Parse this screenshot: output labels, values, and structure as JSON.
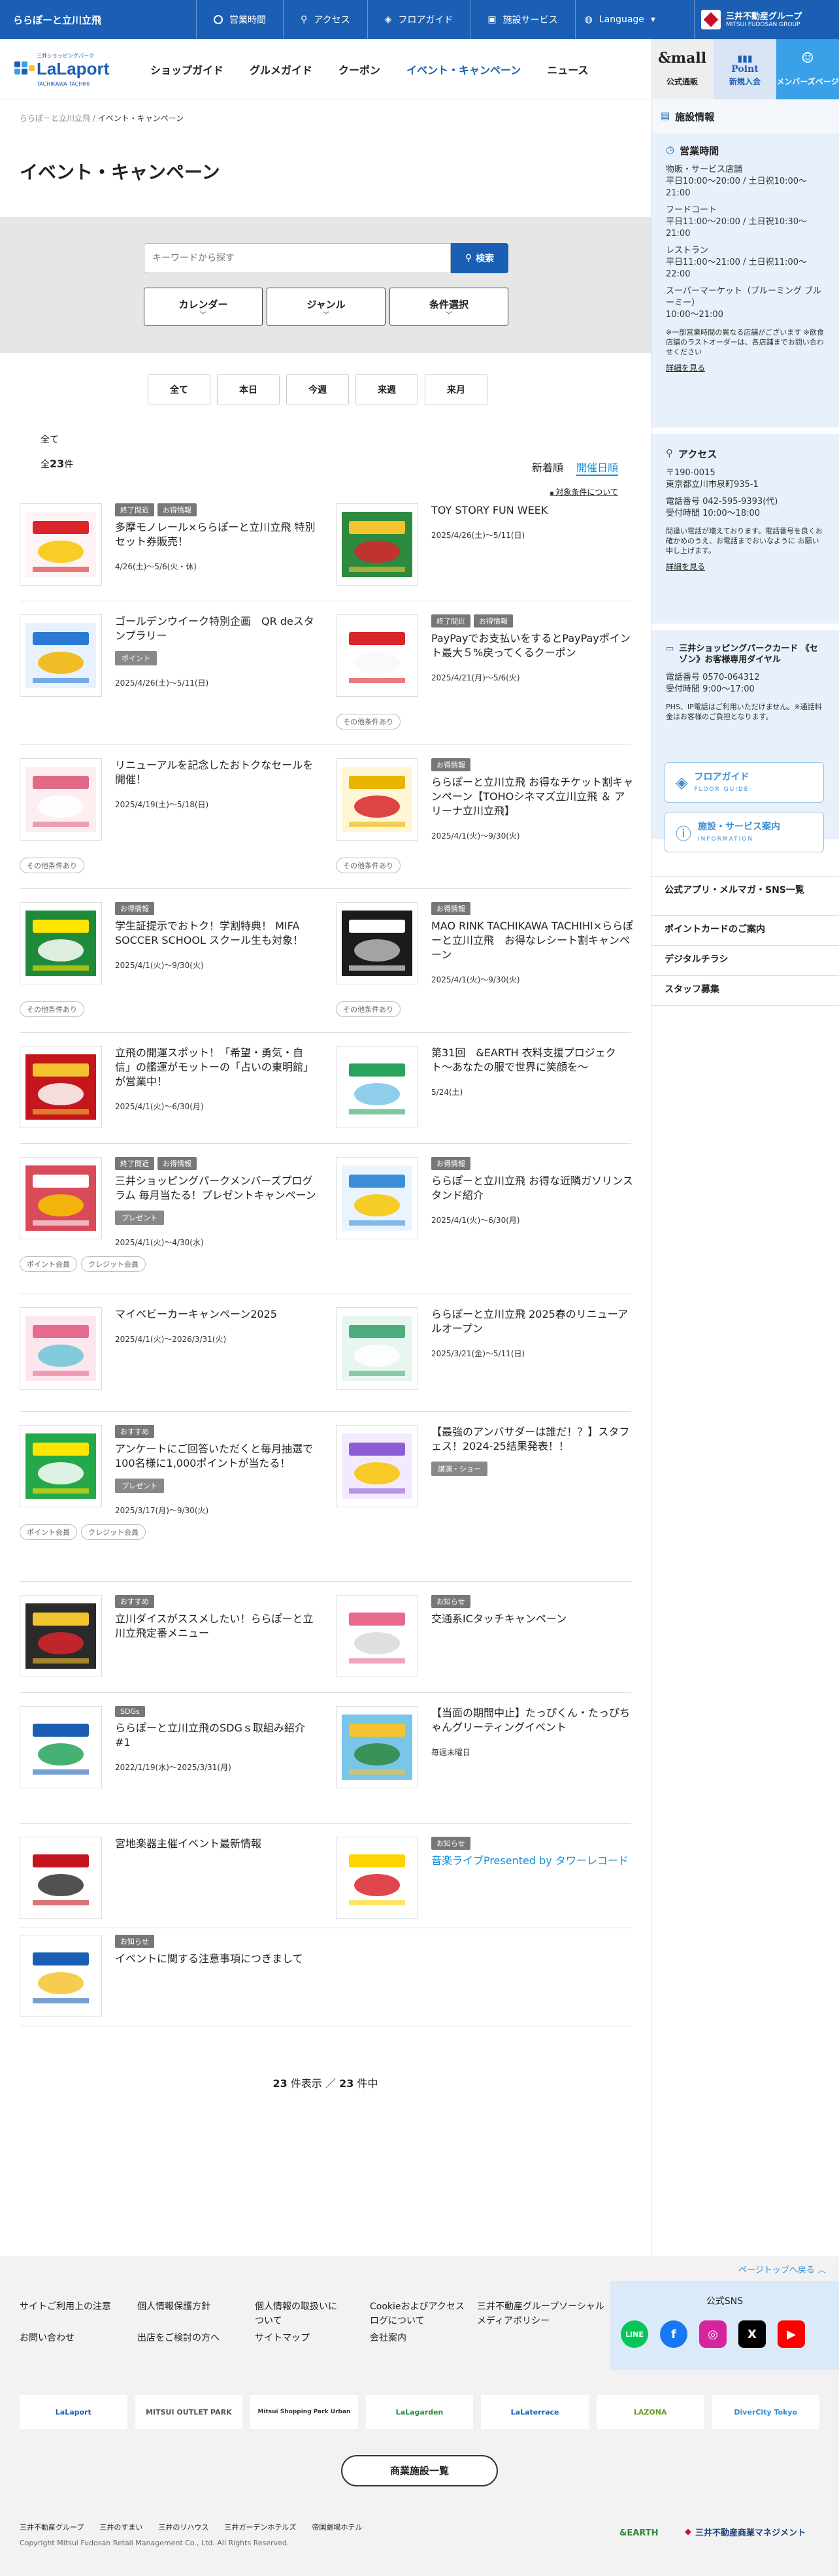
{
  "topbar": {
    "site_name": "ららぽーと立川立飛",
    "nav": [
      "営業時間",
      "アクセス",
      "フロアガイド",
      "施設サービス"
    ],
    "language": "Language",
    "group_name": "三井不動産グループ",
    "group_en": "MITSUI FUDOSAN GROUP"
  },
  "header": {
    "logo_small": "三井ショッピングパーク",
    "logo_main": "LaLaport",
    "logo_sub": "TACHIKAWA TACHIHI",
    "nav": [
      "ショップガイド",
      "グルメガイド",
      "クーポン",
      "イベント・キャンペーン",
      "ニュース"
    ],
    "mall_label": "公式通販",
    "mall_glyph": "&mall",
    "point_label": "新規入会",
    "point_glyph": "Point",
    "member_label": "メンバーズページ"
  },
  "breadcrumb": {
    "home": "ららぽーと立川立飛",
    "sep": "/",
    "current": "イベント・キャンペーン"
  },
  "page_title": "イベント・キャンペーン",
  "search": {
    "placeholder": "キーワードから探す",
    "button": "検索",
    "filters": [
      "カレンダー",
      "ジャンル",
      "条件選択"
    ],
    "chevron": "﹀"
  },
  "periods": [
    "全て",
    "本日",
    "今週",
    "来週",
    "来月"
  ],
  "list": {
    "filter_label": "全て",
    "count_prefix": "全",
    "count": "23",
    "count_suffix": "件",
    "sort_new": "新着順",
    "sort_date": "開催日順",
    "condition_link": "対象条件について"
  },
  "events": [
    {
      "tags": [
        "終了間近",
        "お得情報"
      ],
      "title": "多摩モノレール×ららぽーと立川立飛 特別セット券販売！",
      "date": "4/26(土)〜5/6(火・休)",
      "pills": [],
      "genre": "",
      "art": [
        "#fff3f3",
        "#d9252b",
        "#f7c600"
      ]
    },
    {
      "tags": [],
      "title": "TOY STORY FUN WEEK",
      "date": "2025/4/26(土)〜5/11(日)",
      "pills": [],
      "genre": "",
      "art": [
        "#2d8a3e",
        "#f4c430",
        "#d9252b"
      ]
    },
    {
      "tags": [],
      "title": "ゴールデンウイーク特別企画　QR deスタンプラリー",
      "date": "2025/4/26(土)〜5/11(日)",
      "pills": [],
      "genre": "ポイント",
      "art": [
        "#e8f2ff",
        "#2a7ad6",
        "#f2b400"
      ]
    },
    {
      "tags": [
        "終了間近",
        "お得情報"
      ],
      "title": "PayPayでお支払いをするとPayPayポイント最大５%戻ってくるクーポン",
      "date": "2025/4/21(月)〜5/6(火)",
      "pills": [
        "その他条件あり"
      ],
      "genre": "",
      "art": [
        "#ffffff",
        "#d9252b",
        "#f8f8f8"
      ]
    },
    {
      "tags": [],
      "title": "リニューアルを記念したおトクなセールを開催！",
      "date": "2025/4/19(土)〜5/18(日)",
      "pills": [
        "その他条件あり"
      ],
      "genre": "",
      "art": [
        "#fdeef0",
        "#e06a86",
        "#ffffff"
      ]
    },
    {
      "tags": [
        "お得情報"
      ],
      "title": "ららぽーと立川立飛 お得なチケット割キャンペーン【TOHOシネマズ立川立飛 ＆ アリーナ立川立飛】",
      "date": "2025/4/1(火)〜9/30(火)",
      "pills": [
        "その他条件あり"
      ],
      "genre": "",
      "art": [
        "#fff6d6",
        "#e8b400",
        "#d9252b"
      ]
    },
    {
      "tags": [
        "お得情報"
      ],
      "title": "学生証提示でおトク！学割特典！ MIFA SOCCER SCHOOL スクール生も対象！",
      "date": "2025/4/1(火)〜9/30(火)",
      "pills": [
        "その他条件あり"
      ],
      "genre": "",
      "art": [
        "#1e8a3a",
        "#ffe600",
        "#ffffff"
      ]
    },
    {
      "tags": [
        "お得情報"
      ],
      "title": "MAO RINK TACHIKAWA TACHIHI×ららぽーと立川立飛　お得なレシート割キャンペーン",
      "date": "2025/4/1(火)〜9/30(火)",
      "pills": [
        "その他条件あり"
      ],
      "genre": "",
      "art": [
        "#1b1b1b",
        "#ffffff",
        "#bbbbbb"
      ]
    },
    {
      "tags": [],
      "title": "立飛の開運スポット！「希望・勇気・自信」の艦運がモットーの「占いの東明館」が営業中！",
      "date": "2025/4/1(火)〜6/30(月)",
      "pills": [],
      "genre": "",
      "art": [
        "#c4161c",
        "#f4c430",
        "#ffffff"
      ]
    },
    {
      "tags": [],
      "title": "第31回　&EARTH 衣料支援プロジェクト〜あなたの服で世界に笑顔を〜",
      "date": "5/24(土)",
      "pills": [],
      "genre": "",
      "art": [
        "#ffffff",
        "#27a35a",
        "#7bc6e8"
      ]
    },
    {
      "tags": [
        "終了間近",
        "お得情報"
      ],
      "title": "三井ショッピングパークメンバーズプログラム 毎月当たる！プレゼントキャンペーン",
      "date": "2025/4/1(火)〜4/30(水)",
      "pills": [
        "ポイント会員",
        "クレジット会員"
      ],
      "genre": "プレゼント",
      "art": [
        "#d94a5a",
        "#ffffff",
        "#f7c600"
      ]
    },
    {
      "tags": [
        "お得情報"
      ],
      "title": "ららぽーと立川立飛 お得な近隣ガソリンスタンド紹介",
      "date": "2025/4/1(火)〜6/30(月)",
      "pills": [],
      "genre": "",
      "art": [
        "#e9f4ff",
        "#3a8fd6",
        "#f7c600"
      ]
    },
    {
      "tags": [],
      "title": "マイベビーカーキャンペーン2025",
      "date": "2025/4/1(火)〜2026/3/31(火)",
      "pills": [],
      "genre": "",
      "art": [
        "#fde7ee",
        "#e86a8f",
        "#6cc6d6"
      ]
    },
    {
      "tags": [],
      "title": "ららぽーと立川立飛 2025春のリニューアルオープン",
      "date": "2025/3/21(金)〜5/11(日)",
      "pills": [],
      "genre": "",
      "art": [
        "#e7f6ef",
        "#4cae7a",
        "#ffffff"
      ]
    },
    {
      "tags": [
        "おすすめ"
      ],
      "title": "アンケートにご回答いただくと毎月抽選で100名様に1,000ポイントが当たる！",
      "date": "2025/3/17(月)〜9/30(火)",
      "pills": [
        "ポイント会員",
        "クレジット会員"
      ],
      "genre": "プレゼント",
      "art": [
        "#25a84a",
        "#ffe600",
        "#ffffff"
      ]
    },
    {
      "tags": [],
      "title": "【最強のアンバサダーは誰だ！？】スタフェス！2024-25結果発表！！",
      "date": "",
      "pills": [],
      "genre": "講演・ショー",
      "art": [
        "#f4eaff",
        "#8e5cd6",
        "#f7c600"
      ]
    },
    {
      "tags": [
        "おすすめ"
      ],
      "title": "立川ダイスがススメしたい！ららぽーと立川立飛定番メニュー",
      "date": "",
      "pills": [],
      "genre": "",
      "art": [
        "#2a2a2a",
        "#f4c430",
        "#d9252b"
      ]
    },
    {
      "tags": [
        "お知らせ"
      ],
      "title": "交通系ICタッチキャンペーン",
      "date": "",
      "pills": [],
      "genre": "",
      "art": [
        "#ffffff",
        "#e86a8f",
        "#d9d9d9"
      ]
    },
    {
      "tags": [
        "SDGs"
      ],
      "title": "ららぽーと立川立飛のSDGｓ取組み紹介 #1",
      "date": "2022/1/19(水)〜2025/3/31(月)",
      "pills": [],
      "genre": "",
      "art": [
        "#ffffff",
        "#1a5fb4",
        "#27a35a"
      ]
    },
    {
      "tags": [],
      "title": "【当面の期間中止】たっぴくん・たっぴちゃんグリーティングイベント",
      "date": "毎週末曜日",
      "pills": [],
      "genre": "",
      "art": [
        "#7bc6e8",
        "#f4c430",
        "#2d8a3e"
      ]
    },
    {
      "tags": [],
      "title": "宮地楽器主催イベント最新情報",
      "date": "",
      "pills": [],
      "genre": "",
      "art": [
        "#ffffff",
        "#c4161c",
        "#333333"
      ]
    },
    {
      "tags": [
        "お知らせ"
      ],
      "title": "音楽ライブPresented by タワーレコード",
      "date": "",
      "pills": [],
      "genre": "",
      "art": [
        "#ffffff",
        "#ffd400",
        "#d9252b"
      ],
      "blue": true
    },
    {
      "tags": [
        "お知らせ"
      ],
      "title": "イベントに関する注意事項につきまして",
      "date": "",
      "pills": [],
      "genre": "",
      "art": [
        "#ffffff",
        "#1a5fb4",
        "#f4c430"
      ]
    }
  ],
  "pager": {
    "shown": "23",
    "shown_suffix": "件表示",
    "sep": "／",
    "total": "23",
    "total_suffix": "件中"
  },
  "sidebar": {
    "info_title": "施設情報",
    "hours_title": "営業時間",
    "hours": [
      "物販・サービス店舗",
      "平日10:00〜20:00 / 土日祝10:00〜21:00",
      "フードコート",
      "平日11:00〜20:00 / 土日祝10:30〜21:00",
      "レストラン",
      "平日11:00〜21:00 / 土日祝11:00〜22:00",
      "スーパーマーケット（ブルーミング ブルーミー）",
      "10:00〜21:00"
    ],
    "hours_note": "※一部営業時間の異なる店舗がございます ※飲食店舗のラストオーダーは、各店舗までお問い合わせください",
    "detail": "詳細を見る",
    "access_title": "アクセス",
    "access": [
      "〒190-0015",
      "東京都立川市泉町935-1",
      "電話番号 042-595-9393(代)",
      "受付時間 10:00〜18:00"
    ],
    "access_note": "間違い電話が増えております。電話番号を良くお確かめのうえ、お電話までおいなように お願い申し上げます。",
    "card_title": "三井ショッピングパークカード 《セゾン》お客様専用ダイヤル",
    "card": [
      "電話番号 0570-064312",
      "受付時間 9:00〜17:00"
    ],
    "card_note": "PHS、IP電話はご利用いただけません。※通話料金はお客様のご負担となります。",
    "floor_btn": "フロアガイド",
    "floor_en": "FLOOR GUIDE",
    "info_btn": "施設・サービス案内",
    "info_en": "INFORMATION",
    "links": [
      "公式アプリ・メルマガ・SNS一覧",
      "ポイントカードのご案内",
      "デジタルチラシ",
      "スタッフ募集"
    ]
  },
  "pagetop": "ページトップへ戻る",
  "footer": {
    "links": [
      "サイトご利用上の注意",
      "お問い合わせ",
      "個人情報保護方針",
      "出店をご検討の方へ",
      "個人情報の取扱いについて",
      "サイトマップ",
      "Cookieおよびアクセスログについて",
      "会社案内",
      "三井不動産グループソーシャルメディアポリシー"
    ],
    "sns_title": "公式SNS",
    "brands": [
      "LaLaport",
      "MITSUI OUTLET PARK",
      "Mitsui Shopping Park Urban",
      "LaLagarden",
      "LaLaterrace",
      "LAZONA",
      "DiverCity Tokyo"
    ],
    "list_btn": "商業施設一覧",
    "group": [
      "三井不動産グループ",
      "三井のすまい",
      "三井のリハウス",
      "三井ガーデンホテルズ",
      "帝国劇場ホテル"
    ],
    "copyright": "Copyright Mitsui Fudosan Retail Management Co., Ltd. All Rights Reserved.",
    "earth": "&EARTH",
    "mrm": "三井不動産商業マネジメント"
  },
  "colors": {
    "brand": "#1a5fb4",
    "accent": "#1a8fd6"
  }
}
